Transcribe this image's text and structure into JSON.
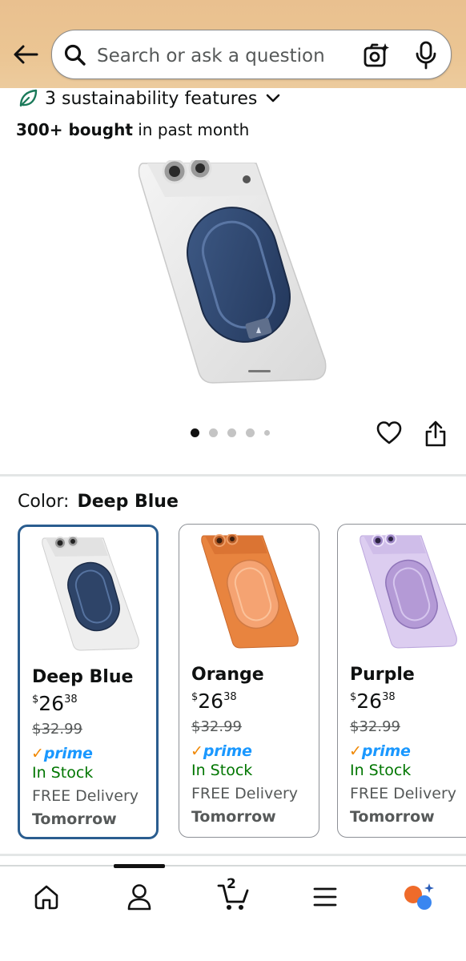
{
  "header": {
    "search_placeholder": "Search or ask a question",
    "back_icon": "back-arrow-icon",
    "search_icon": "search-icon",
    "camera_icon": "camera-lens-icon",
    "mic_icon": "microphone-icon",
    "background_color": "#ebc593"
  },
  "sustainability": {
    "label": "3 sustainability features"
  },
  "bought": {
    "bold": "300+ bought",
    "rest": " in past month"
  },
  "gallery": {
    "image_count": 5,
    "active_index": 0
  },
  "color_selector": {
    "label": "Color:",
    "selected": "Deep Blue",
    "selected_border": "#2a5d8f",
    "options": [
      {
        "name": "Deep Blue",
        "price_symbol": "$",
        "price_whole": "26",
        "price_fraction": "38",
        "list_price": "$32.99",
        "prime_check": "✓",
        "prime_word": "prime",
        "stock": "In Stock",
        "delivery": "FREE Delivery",
        "delivery_day": "Tomorrow",
        "swatch_color": "#2e4468"
      },
      {
        "name": "Orange",
        "price_symbol": "$",
        "price_whole": "26",
        "price_fraction": "38",
        "list_price": "$32.99",
        "prime_check": "✓",
        "prime_word": "prime",
        "stock": "In Stock",
        "delivery": "FREE Delivery",
        "delivery_day": "Tomorrow",
        "swatch_color": "#e07a3a"
      },
      {
        "name": "Purple",
        "price_symbol": "$",
        "price_whole": "26",
        "price_fraction": "38",
        "list_price": "$32.99",
        "prime_check": "✓",
        "prime_word": "prime",
        "stock": "In Stock",
        "delivery": "FREE Delivery",
        "delivery_day": "Tomorrow",
        "swatch_color": "#b49ad6"
      }
    ]
  },
  "bottom_nav": {
    "cart_count": "2",
    "items": [
      "home-icon",
      "account-icon",
      "cart-icon",
      "menu-icon",
      "rufus-icon"
    ]
  }
}
